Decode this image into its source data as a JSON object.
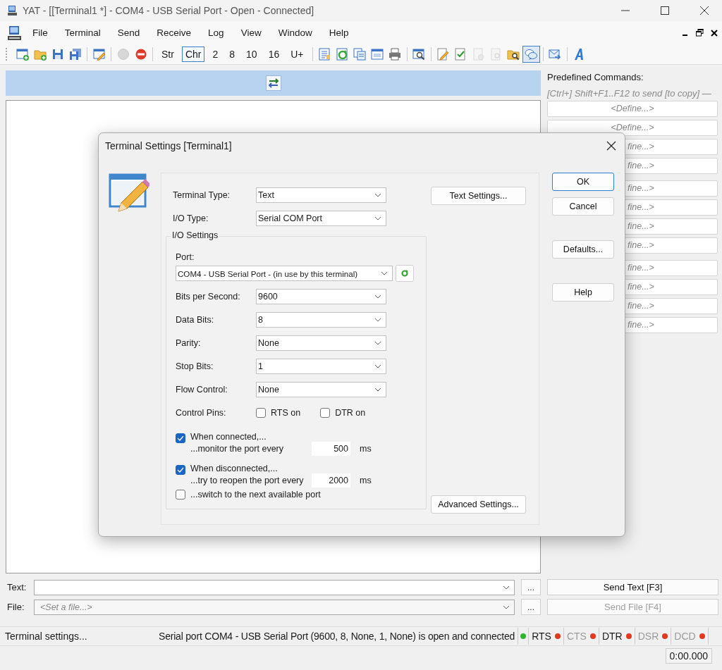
{
  "window": {
    "title": "YAT - [[Terminal1 *] - COM4 - USB Serial Port - Open - Connected]"
  },
  "menu": [
    "File",
    "Terminal",
    "Send",
    "Receive",
    "Log",
    "View",
    "Window",
    "Help"
  ],
  "toolbar": [
    {
      "kind": "icon",
      "disabled": false,
      "selected": false
    },
    {
      "kind": "icon",
      "disabled": false,
      "selected": false
    },
    {
      "kind": "icon",
      "disabled": false,
      "selected": false
    },
    {
      "kind": "icon",
      "disabled": false,
      "selected": false
    },
    {
      "kind": "separator"
    },
    {
      "kind": "icon",
      "disabled": false,
      "selected": false
    },
    {
      "kind": "separator"
    },
    {
      "kind": "icon",
      "disabled": true,
      "selected": false
    },
    {
      "kind": "icon",
      "disabled": false,
      "selected": false
    },
    {
      "kind": "separator"
    },
    {
      "kind": "text",
      "label": "Str",
      "selected": false
    },
    {
      "kind": "text",
      "label": "Chr",
      "selected": true
    },
    {
      "kind": "text",
      "label": "2",
      "selected": false
    },
    {
      "kind": "text",
      "label": "8",
      "selected": false
    },
    {
      "kind": "text",
      "label": "10",
      "selected": false
    },
    {
      "kind": "text",
      "label": "16",
      "selected": false
    },
    {
      "kind": "text",
      "label": "U+",
      "selected": false
    },
    {
      "kind": "separator"
    },
    {
      "kind": "icon",
      "disabled": false,
      "selected": false
    },
    {
      "kind": "icon",
      "disabled": false,
      "selected": false
    },
    {
      "kind": "icon",
      "disabled": false,
      "selected": false
    },
    {
      "kind": "icon",
      "disabled": false,
      "selected": false
    },
    {
      "kind": "icon",
      "disabled": false,
      "selected": false
    },
    {
      "kind": "separator"
    },
    {
      "kind": "icon",
      "disabled": false,
      "selected": false
    },
    {
      "kind": "separator"
    },
    {
      "kind": "icon",
      "disabled": false,
      "selected": false
    },
    {
      "kind": "icon",
      "disabled": false,
      "selected": false
    },
    {
      "kind": "icon",
      "disabled": true,
      "selected": false
    },
    {
      "kind": "icon",
      "disabled": true,
      "selected": false
    },
    {
      "kind": "icon",
      "disabled": false,
      "selected": false
    },
    {
      "kind": "icon",
      "disabled": false,
      "selected": true
    },
    {
      "kind": "separator"
    },
    {
      "kind": "icon",
      "disabled": false,
      "selected": false
    },
    {
      "kind": "separator"
    },
    {
      "kind": "icon",
      "disabled": false,
      "selected": false
    }
  ],
  "predefined": {
    "title": "Predefined Commands:",
    "hint": "[Ctrl+] Shift+F1..F12 to send [to copy] —",
    "groups": [
      {
        "commands": [
          {
            "label": "<Define...>",
            "kind": "full"
          },
          {
            "label": "<Define...>",
            "kind": "full"
          },
          {
            "label": "fine...>",
            "kind": "partial"
          },
          {
            "label": "fine...>",
            "kind": "partial"
          }
        ]
      },
      {
        "commands": [
          {
            "label": "fine...>",
            "kind": "partial"
          },
          {
            "label": "fine...>",
            "kind": "partial"
          },
          {
            "label": "fine...>",
            "kind": "partial"
          },
          {
            "label": "fine...>",
            "kind": "partial"
          }
        ]
      },
      {
        "commands": [
          {
            "label": "fine...>",
            "kind": "partial"
          },
          {
            "label": "fine...>",
            "kind": "partial"
          },
          {
            "label": "fine...>",
            "kind": "partial"
          },
          {
            "label": "fine...>",
            "kind": "partial"
          }
        ]
      }
    ]
  },
  "send_rows": [
    {
      "label": "Text:",
      "browse": "...",
      "button": "Send Text [F3]",
      "disabled": false
    },
    {
      "label": "File:",
      "placeholder": "<Set a file...>",
      "browse": "...",
      "button": "Send File [F4]",
      "disabled": true
    }
  ],
  "status_bar": {
    "left": "Terminal settings...",
    "message": "Serial port COM4 - USB Serial Port (9600, 8, None, 1, None) is open and connected",
    "connection_led": {
      "color": "#2fb52f"
    },
    "pins": [
      {
        "label": "RTS",
        "disabled": false,
        "color": "#e2381f"
      },
      {
        "label": "CTS",
        "disabled": true,
        "color": "#e2381f"
      },
      {
        "label": "DTR",
        "disabled": false,
        "color": "#e2381f"
      },
      {
        "label": "DSR",
        "disabled": true,
        "color": "#e2381f"
      },
      {
        "label": "DCD",
        "disabled": true,
        "color": "#e2381f"
      }
    ],
    "timer": "0:00.000"
  },
  "dialog": {
    "title": "Terminal Settings [Terminal1]",
    "top_fields": [
      {
        "label": "Terminal Type:",
        "value": "Text"
      },
      {
        "label": "I/O Type:",
        "value": "Serial COM Port"
      }
    ],
    "text_settings_button": "Text Settings...",
    "io_settings": {
      "title": "I/O Settings",
      "port": {
        "label": "Port:",
        "value": "COM4 - USB Serial Port - (in use by this terminal)"
      },
      "fields": [
        {
          "label": "Bits per Second:",
          "value": "9600"
        },
        {
          "label": "Data Bits:",
          "value": "8"
        },
        {
          "label": "Parity:",
          "value": "None"
        },
        {
          "label": "Stop Bits:",
          "value": "1"
        },
        {
          "label": "Flow Control:",
          "value": "None"
        }
      ],
      "control_pins": {
        "label": "Control Pins:",
        "options": [
          {
            "label": "RTS on",
            "checked": false
          },
          {
            "label": "DTR on",
            "checked": false
          }
        ]
      },
      "timers": [
        {
          "checked": true,
          "line1": "When connected,...",
          "line2": "...monitor the port every",
          "value": "500",
          "unit": "ms"
        },
        {
          "checked": true,
          "line1": "When disconnected,...",
          "line2": "...try to reopen the port every",
          "value": "2000",
          "unit": "ms"
        }
      ],
      "switch": {
        "checked": false,
        "label": "...switch to the next available port"
      }
    },
    "advanced_button": "Advanced Settings...",
    "button_groups": [
      [
        {
          "label": "OK",
          "default": true
        },
        {
          "label": "Cancel",
          "default": false
        }
      ],
      [
        {
          "label": "Defaults...",
          "default": false
        }
      ],
      [
        {
          "label": "Help",
          "default": false
        }
      ]
    ]
  }
}
